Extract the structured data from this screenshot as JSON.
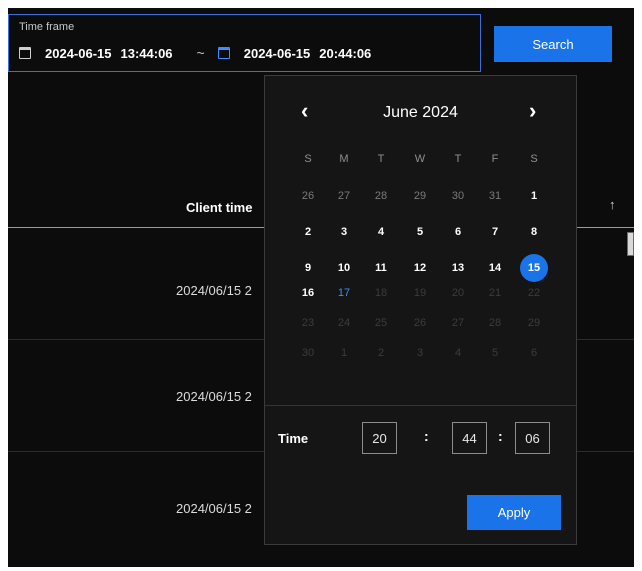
{
  "timeframe": {
    "label": "Time frame",
    "start_date": "2024-06-15",
    "start_time": "13:44:06",
    "separator": "~",
    "end_date": "2024-06-15",
    "end_time": "20:44:06",
    "calendar_icon": "calendar-icon"
  },
  "search": {
    "label": "Search"
  },
  "table": {
    "column_header": "Client time",
    "sort_icon": "↑",
    "rows": [
      "2024/06/15 2",
      "2024/06/15 2",
      "2024/06/15 2"
    ]
  },
  "picker": {
    "month_label": "June 2024",
    "prev_icon": "‹",
    "next_icon": "›",
    "weekdays": [
      "S",
      "M",
      "T",
      "W",
      "T",
      "F",
      "S"
    ],
    "weeks": [
      [
        {
          "d": "26",
          "s": "muted"
        },
        {
          "d": "27",
          "s": "muted"
        },
        {
          "d": "28",
          "s": "muted"
        },
        {
          "d": "29",
          "s": "muted"
        },
        {
          "d": "30",
          "s": "muted"
        },
        {
          "d": "31",
          "s": "muted"
        },
        {
          "d": "1",
          "s": "active"
        }
      ],
      [
        {
          "d": "2",
          "s": "active"
        },
        {
          "d": "3",
          "s": "active"
        },
        {
          "d": "4",
          "s": "active"
        },
        {
          "d": "5",
          "s": "active"
        },
        {
          "d": "6",
          "s": "active"
        },
        {
          "d": "7",
          "s": "active"
        },
        {
          "d": "8",
          "s": "active"
        }
      ],
      [
        {
          "d": "9",
          "s": "active"
        },
        {
          "d": "10",
          "s": "active"
        },
        {
          "d": "11",
          "s": "active"
        },
        {
          "d": "12",
          "s": "active"
        },
        {
          "d": "13",
          "s": "active"
        },
        {
          "d": "14",
          "s": "active"
        },
        {
          "d": "15",
          "s": "selected"
        }
      ],
      [
        {
          "d": "16",
          "s": "active"
        },
        {
          "d": "17",
          "s": "today"
        },
        {
          "d": "18",
          "s": "faded"
        },
        {
          "d": "19",
          "s": "faded"
        },
        {
          "d": "20",
          "s": "faded"
        },
        {
          "d": "21",
          "s": "faded"
        },
        {
          "d": "22",
          "s": "faded"
        }
      ],
      [
        {
          "d": "23",
          "s": "faded"
        },
        {
          "d": "24",
          "s": "faded"
        },
        {
          "d": "25",
          "s": "faded"
        },
        {
          "d": "26",
          "s": "faded"
        },
        {
          "d": "27",
          "s": "faded"
        },
        {
          "d": "28",
          "s": "faded"
        },
        {
          "d": "29",
          "s": "faded"
        }
      ],
      [
        {
          "d": "30",
          "s": "faded"
        },
        {
          "d": "1",
          "s": "faded"
        },
        {
          "d": "2",
          "s": "faded"
        },
        {
          "d": "3",
          "s": "faded"
        },
        {
          "d": "4",
          "s": "faded"
        },
        {
          "d": "5",
          "s": "faded"
        },
        {
          "d": "6",
          "s": "faded"
        }
      ]
    ],
    "time_label": "Time",
    "hours": "20",
    "minutes": "44",
    "seconds": "06",
    "time_separator": ":",
    "apply_label": "Apply"
  },
  "colors": {
    "accent": "#1a73e8",
    "background": "#0c0c0c",
    "popup_background": "#151515",
    "today": "#3f8cff"
  }
}
